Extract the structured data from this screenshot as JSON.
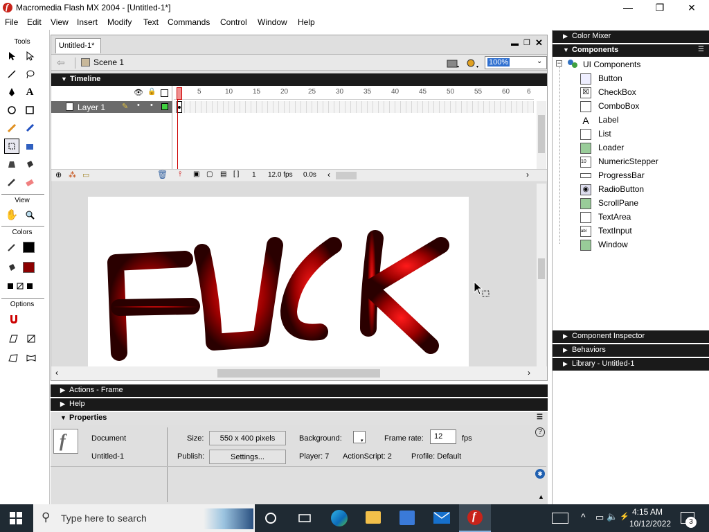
{
  "titlebar": {
    "title": "Macromedia Flash MX 2004 - [Untitled-1*]",
    "min": "—",
    "max": "❐",
    "close": "✕"
  },
  "menu": [
    "File",
    "Edit",
    "View",
    "Insert",
    "Modify",
    "Text",
    "Commands",
    "Control",
    "Window",
    "Help"
  ],
  "tools": {
    "header": "Tools",
    "view_header": "View",
    "colors_header": "Colors",
    "options_header": "Options"
  },
  "document": {
    "tab": "Untitled-1*",
    "scene": "Scene 1",
    "zoom": "100%",
    "timeline_header": "Timeline",
    "layer_name": "Layer 1",
    "frame_numbers": [
      "5",
      "10",
      "15",
      "20",
      "25",
      "30",
      "35",
      "40",
      "45",
      "50",
      "55",
      "60",
      "6"
    ],
    "current_frame": "1",
    "fps": "12.0 fps",
    "elapsed": "0.0s",
    "stage_text": "FUCK"
  },
  "panels": {
    "actions": "Actions - Frame",
    "help": "Help",
    "properties": "Properties"
  },
  "properties": {
    "type": "Document",
    "name": "Untitled-1",
    "size_label": "Size:",
    "size_value": "550 x 400 pixels",
    "publish_label": "Publish:",
    "settings_button": "Settings...",
    "background_label": "Background:",
    "framerate_label": "Frame rate:",
    "framerate_value": "12",
    "fps_unit": "fps",
    "player": "Player: 7",
    "actionscript": "ActionScript: 2",
    "profile": "Profile: Default"
  },
  "right_panel": {
    "color_mixer": "Color Mixer",
    "components": "Components",
    "ui_components": "UI Components",
    "items": [
      "Button",
      "CheckBox",
      "ComboBox",
      "Label",
      "List",
      "Loader",
      "NumericStepper",
      "ProgressBar",
      "RadioButton",
      "ScrollPane",
      "TextArea",
      "TextInput",
      "Window"
    ],
    "component_inspector": "Component Inspector",
    "behaviors": "Behaviors",
    "library": "Library - Untitled-1"
  },
  "taskbar": {
    "search_placeholder": "Type here to search",
    "time": "4:15 AM",
    "date": "10/12/2022",
    "notifications": "3"
  },
  "colors": {
    "accent_red": "#c8231a",
    "panel_header": "#1a1a1a",
    "taskbar": "#1f2a33"
  }
}
